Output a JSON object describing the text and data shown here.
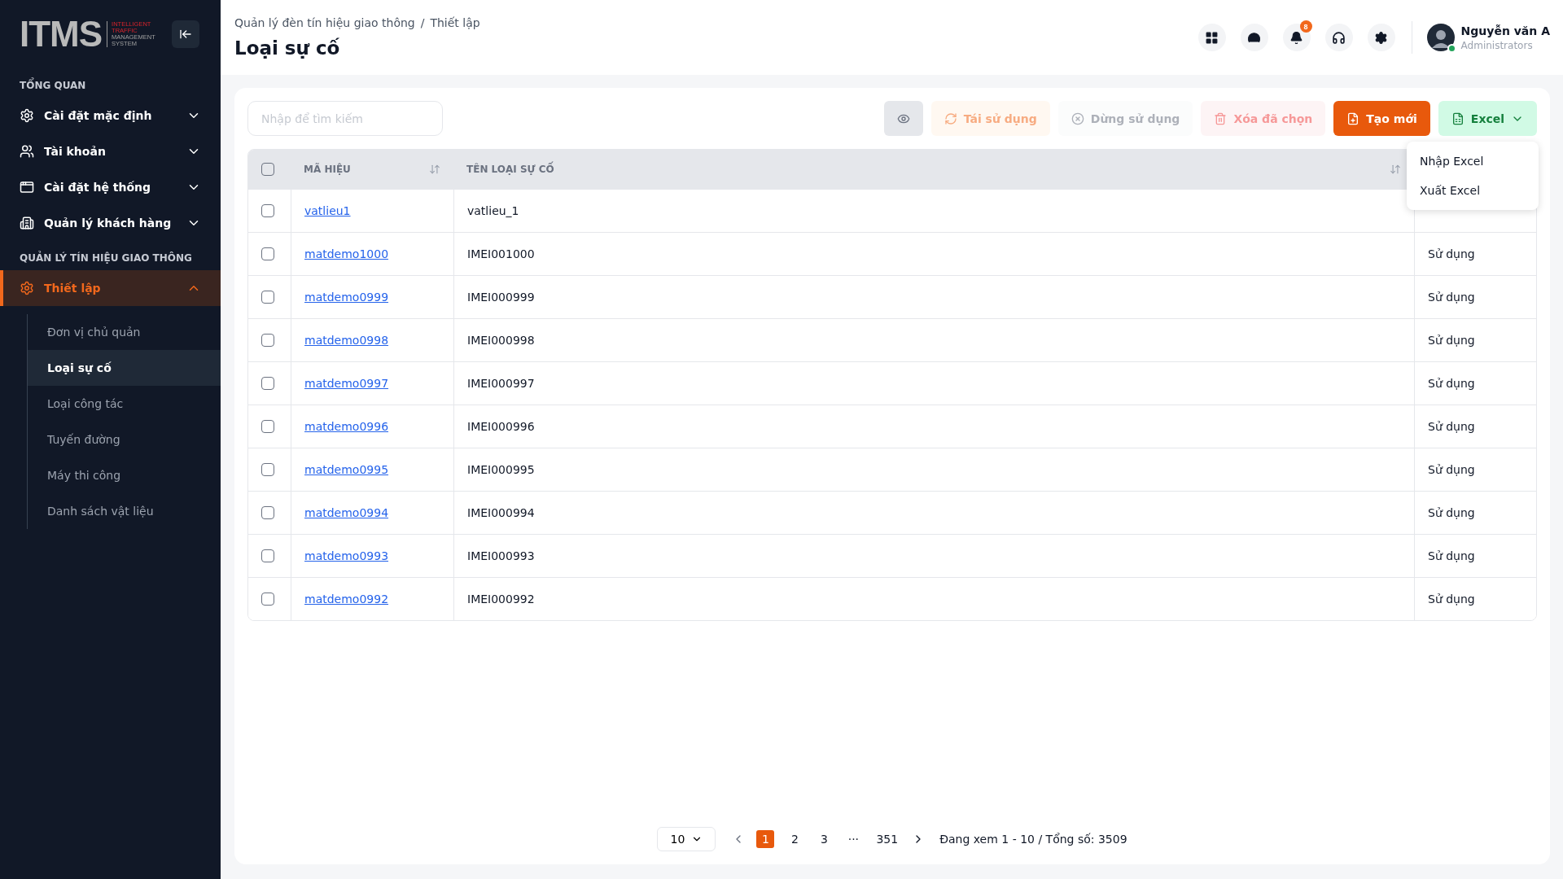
{
  "sidebar": {
    "logo": {
      "mark": "ITMS",
      "lines": [
        "INTELLIGENT",
        "TRAFFIC",
        "MANAGEMENT",
        "SYSTEM"
      ]
    },
    "sections": [
      {
        "title": "TỔNG QUAN",
        "items": [
          {
            "label": "Cài đặt mặc định",
            "expanded": false,
            "selected": false
          },
          {
            "label": "Tài khoản",
            "expanded": false,
            "selected": false
          },
          {
            "label": "Cài đặt hệ thống",
            "expanded": false,
            "selected": false
          },
          {
            "label": "Quản lý khách hàng",
            "expanded": false,
            "selected": false
          }
        ]
      },
      {
        "title": "QUẢN LÝ TÍN HIỆU GIAO THÔNG",
        "items": [
          {
            "label": "Thiết lập",
            "expanded": true,
            "selected": true,
            "children": [
              {
                "label": "Đơn vị chủ quản",
                "selected": false
              },
              {
                "label": "Loại sự cố",
                "selected": true
              },
              {
                "label": "Loại công tác",
                "selected": false
              },
              {
                "label": "Tuyến đường",
                "selected": false
              },
              {
                "label": "Máy thi công",
                "selected": false
              },
              {
                "label": "Danh sách vật liệu",
                "selected": false
              }
            ]
          }
        ]
      }
    ]
  },
  "header": {
    "breadcrumb": [
      "Quản lý đèn tín hiệu giao thông",
      "Thiết lập"
    ],
    "breadcrumb_separator": "/",
    "title": "Loại sự cố",
    "notification_count": "8",
    "user": {
      "name": "Nguyễn văn A",
      "role": "Administrators",
      "online": true
    }
  },
  "toolbar": {
    "search": {
      "placeholder": "Nhập để tìm kiếm"
    },
    "buttons": [
      {
        "kind": "view",
        "disabled": false
      },
      {
        "kind": "reuse",
        "label": "Tái sử dụng",
        "disabled": true
      },
      {
        "kind": "stop",
        "label": "Dừng sử dụng",
        "disabled": true
      },
      {
        "kind": "delete",
        "label": "Xóa đã chọn",
        "disabled": true
      },
      {
        "kind": "create",
        "label": "Tạo mới",
        "disabled": false
      },
      {
        "kind": "excel",
        "label": "Excel",
        "disabled": false,
        "expanded": true,
        "menu": [
          "Nhập Excel",
          "Xuất Excel"
        ]
      }
    ]
  },
  "table": {
    "select_all": {
      "checked": false
    },
    "columns": [
      {
        "label": "MÃ HIỆU",
        "sortable": true
      },
      {
        "label": "TÊN LOẠI SỰ CỐ",
        "sortable": true
      }
    ],
    "rows": [
      {
        "checked": false,
        "code": "vatlieu1",
        "name": "vatlieu_1"
      },
      {
        "checked": false,
        "code": "matdemo1000",
        "name": "IMEI001000",
        "status": "Sử dụng"
      },
      {
        "checked": false,
        "code": "matdemo0999",
        "name": "IMEI000999",
        "status": "Sử dụng"
      },
      {
        "checked": false,
        "code": "matdemo0998",
        "name": "IMEI000998",
        "status": "Sử dụng"
      },
      {
        "checked": false,
        "code": "matdemo0997",
        "name": "IMEI000997",
        "status": "Sử dụng"
      },
      {
        "checked": false,
        "code": "matdemo0996",
        "name": "IMEI000996",
        "status": "Sử dụng"
      },
      {
        "checked": false,
        "code": "matdemo0995",
        "name": "IMEI000995",
        "status": "Sử dụng"
      },
      {
        "checked": false,
        "code": "matdemo0994",
        "name": "IMEI000994",
        "status": "Sử dụng"
      },
      {
        "checked": false,
        "code": "matdemo0993",
        "name": "IMEI000993",
        "status": "Sử dụng"
      },
      {
        "checked": false,
        "code": "matdemo0992",
        "name": "IMEI000992",
        "status": "Sử dụng"
      }
    ]
  },
  "pagination": {
    "page_size": "10",
    "pages": [
      {
        "label": "1",
        "selected": true
      },
      {
        "label": "2",
        "selected": false
      },
      {
        "label": "3",
        "selected": false
      },
      {
        "label": "···",
        "selected": false
      },
      {
        "label": "351",
        "selected": false
      }
    ],
    "summary": "Đang xem 1 - 10 / Tổng số: 3509"
  }
}
